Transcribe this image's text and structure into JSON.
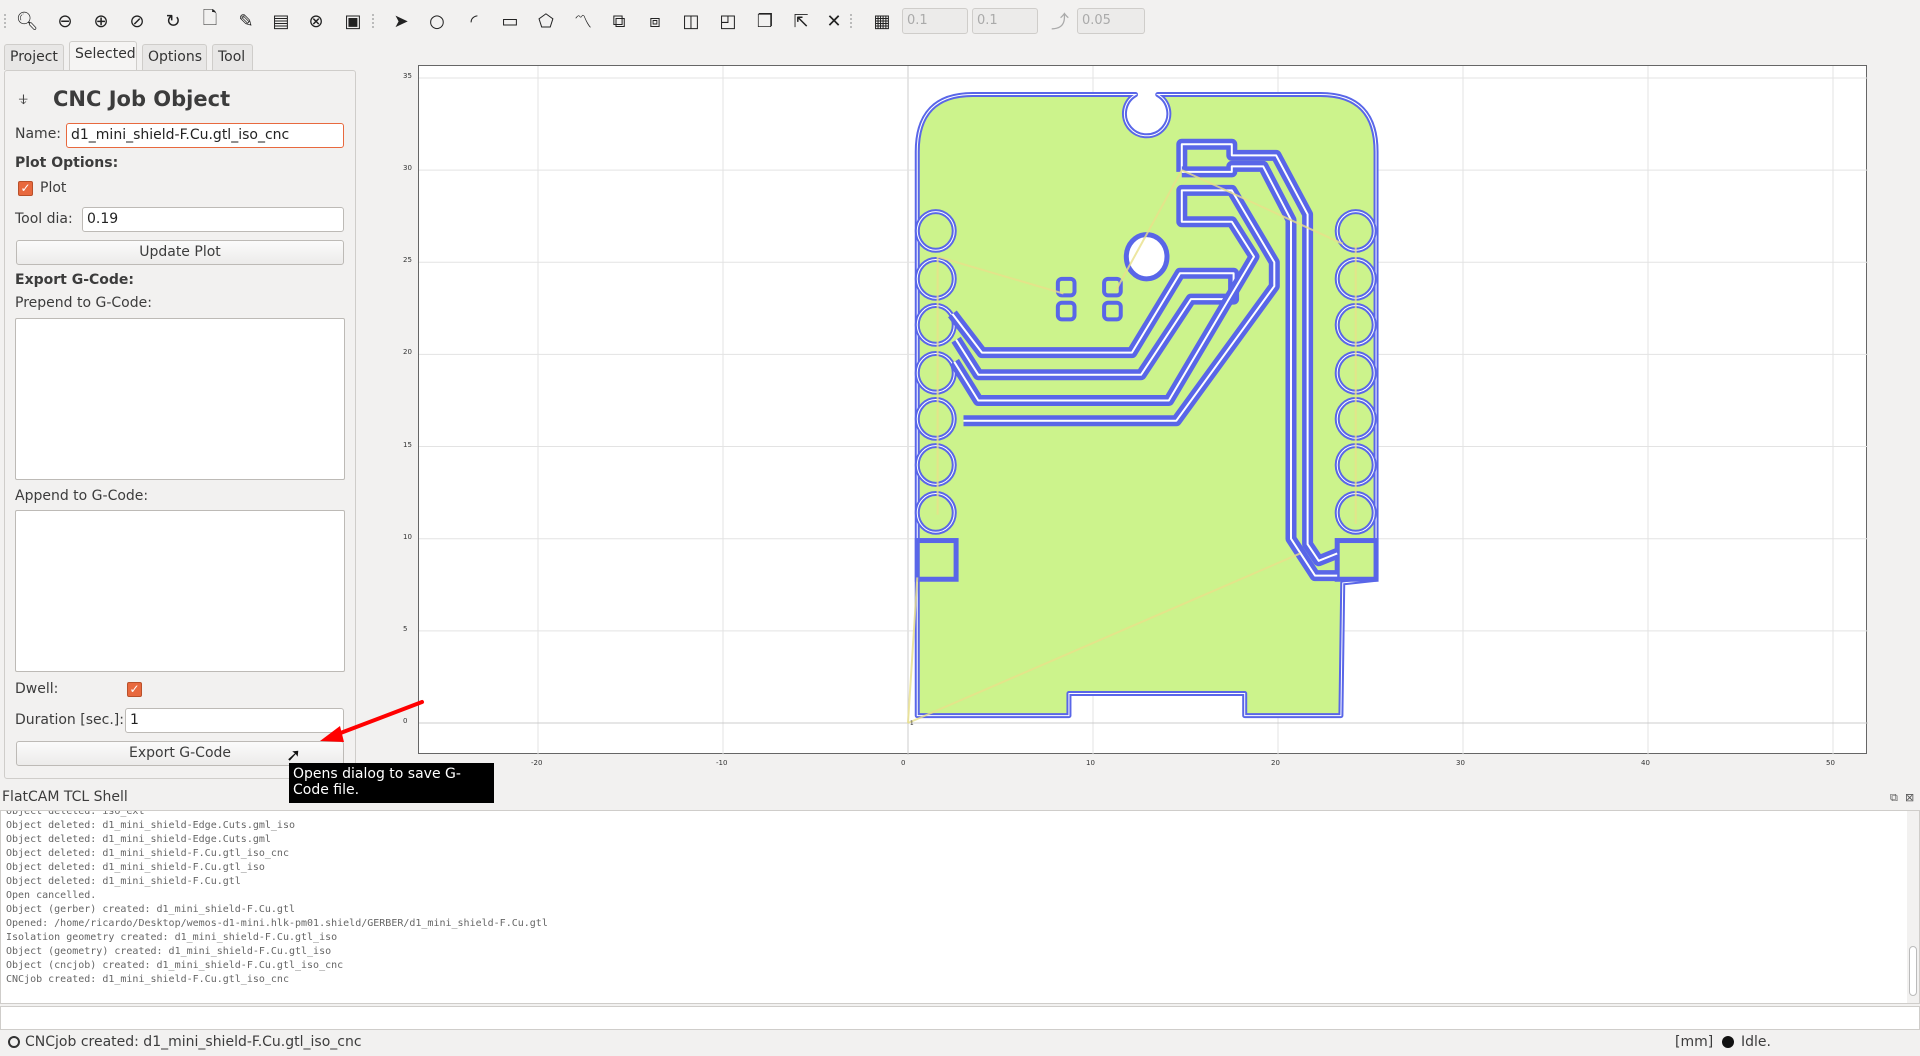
{
  "toolbar": {
    "icons": [
      "zoom-fit-icon",
      "zoom-out-icon",
      "zoom-in-icon",
      "clear-plot-icon",
      "replot-icon",
      "new-geometry-icon",
      "edit-geometry-icon",
      "update-geometry-icon",
      "delete-icon",
      "shell-icon",
      "select-icon",
      "circle-icon",
      "arc-icon",
      "rectangle-icon",
      "polygon-icon",
      "path-icon",
      "union-icon",
      "intersection-icon",
      "subtract-icon",
      "cut-path-icon",
      "copy-icon",
      "move-icon",
      "delete-shape-icon",
      "grid-snap-icon",
      "snap-max-icon"
    ],
    "grid_x": "0.1",
    "grid_y": "0.1",
    "snap_max": "0.05"
  },
  "tabs": [
    {
      "label": "Project"
    },
    {
      "label": "Selected"
    },
    {
      "label": "Options"
    },
    {
      "label": "Tool"
    }
  ],
  "panel": {
    "title": "CNC Job Object",
    "name_label": "Name:",
    "name_value": "d1_mini_shield-F.Cu.gtl_iso_cnc",
    "plot_options_label": "Plot Options:",
    "plot_label": "Plot",
    "plot_checked": true,
    "tool_dia_label": "Tool dia:",
    "tool_dia_value": "0.19",
    "update_plot": "Update Plot",
    "export_label": "Export G-Code:",
    "prepend_label": "Prepend to G-Code:",
    "prepend_value": "",
    "append_label": "Append to G-Code:",
    "append_value": "",
    "dwell_label": "Dwell:",
    "dwell_checked": true,
    "duration_label": "Duration [sec.]:",
    "duration_value": "1",
    "export_button": "Export G-Code"
  },
  "tooltip": "Opens dialog to save G-Code file.",
  "plot": {
    "x_ticks": [
      "-20",
      "-10",
      "0",
      "10",
      "20",
      "30",
      "40",
      "50"
    ],
    "y_ticks": [
      "0",
      "5",
      "10",
      "15",
      "20",
      "25",
      "30",
      "35"
    ],
    "colors": {
      "fill": "#ccf38c",
      "isolation": "#5966e8",
      "travel": "#e8e08a"
    },
    "origin_label": "1"
  },
  "shell": {
    "title": "FlatCAM TCL Shell",
    "lines": [
      "Object deleted: iso_ext",
      "Object deleted: d1_mini_shield-Edge.Cuts.gml_iso",
      "Object deleted: d1_mini_shield-Edge.Cuts.gml",
      "Object deleted: d1_mini_shield-F.Cu.gtl_iso_cnc",
      "Object deleted: d1_mini_shield-F.Cu.gtl_iso",
      "Object deleted: d1_mini_shield-F.Cu.gtl",
      "Open cancelled.",
      "Object (gerber) created: d1_mini_shield-F.Cu.gtl",
      "Opened: /home/ricardo/Desktop/wemos-d1-mini.hlk-pm01.shield/GERBER/d1_mini_shield-F.Cu.gtl",
      "Isolation geometry created: d1_mini_shield-F.Cu.gtl_iso",
      "Object (geometry) created: d1_mini_shield-F.Cu.gtl_iso",
      "Object (cncjob) created: d1_mini_shield-F.Cu.gtl_iso_cnc",
      "CNCjob created: d1_mini_shield-F.Cu.gtl_iso_cnc"
    ],
    "input_value": ""
  },
  "status": {
    "message": "CNCjob created: d1_mini_shield-F.Cu.gtl_iso_cnc",
    "units": "[mm]",
    "state": "Idle."
  }
}
